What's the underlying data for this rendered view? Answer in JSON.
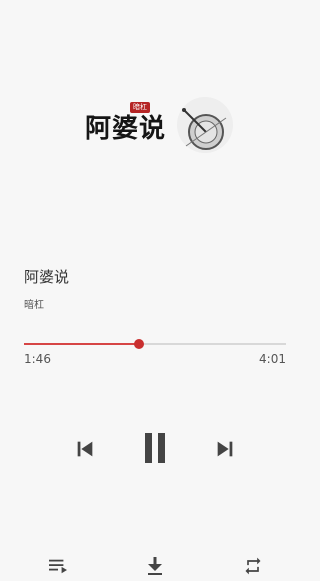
{
  "cover": {
    "title_art": "阿婆说",
    "stamp": "暗杠"
  },
  "track": {
    "title": "阿婆说",
    "artist": "暗杠"
  },
  "progress": {
    "elapsed": "1:46",
    "total": "4:01",
    "fraction": 0.44
  },
  "controls": {
    "prev_icon": "skip-previous-icon",
    "play_pause_icon": "pause-icon",
    "next_icon": "skip-next-icon"
  },
  "bottom_bar": {
    "playlist_icon": "playlist-icon",
    "download_icon": "download-icon",
    "repeat_icon": "repeat-icon"
  },
  "colors": {
    "accent": "#d64545",
    "icon": "#444444",
    "background": "#f7f7f7"
  }
}
